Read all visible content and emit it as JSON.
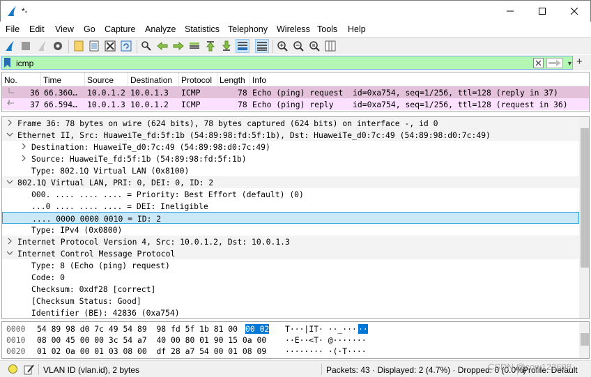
{
  "window": {
    "title": "*-"
  },
  "menu": [
    "File",
    "Edit",
    "View",
    "Go",
    "Capture",
    "Analyze",
    "Statistics",
    "Telephony",
    "Wireless",
    "Tools",
    "Help"
  ],
  "filter": {
    "value": "icmp"
  },
  "packet_list": {
    "columns": [
      "No.",
      "Time",
      "Source",
      "Destination",
      "Protocol",
      "Length",
      "Info"
    ],
    "rows": [
      {
        "no": "36",
        "time": "66.360…",
        "src": "10.0.1.2",
        "dst": "10.0.1.3",
        "proto": "ICMP",
        "len": "78",
        "info": "Echo (ping) request  id=0xa754, seq=1/256, ttl=128 (reply in 37)"
      },
      {
        "no": "37",
        "time": "66.594…",
        "src": "10.0.1.3",
        "dst": "10.0.1.2",
        "proto": "ICMP",
        "len": "78",
        "info": "Echo (ping) reply    id=0xa754, seq=1/256, ttl=128 (request in 36)"
      }
    ]
  },
  "details": [
    {
      "text": "Frame 36: 78 bytes on wire (624 bits), 78 bytes captured (624 bits) on interface -, id 0",
      "arrow": "right"
    },
    {
      "text": "Ethernet II, Src: HuaweiTe_fd:5f:1b (54:89:98:fd:5f:1b), Dst: HuaweiTe_d0:7c:49 (54:89:98:d0:7c:49)",
      "arrow": "down"
    },
    {
      "text": "Destination: HuaweiTe_d0:7c:49 (54:89:98:d0:7c:49)",
      "arrow": "right"
    },
    {
      "text": "Source: HuaweiTe_fd:5f:1b (54:89:98:fd:5f:1b)",
      "arrow": "right"
    },
    {
      "text": "Type: 802.1Q Virtual LAN (0x8100)",
      "arrow": ""
    },
    {
      "text": "802.1Q Virtual LAN, PRI: 0, DEI: 0, ID: 2",
      "arrow": "down"
    },
    {
      "text": "000. .... .... .... = Priority: Best Effort (default) (0)",
      "arrow": ""
    },
    {
      "text": "...0 .... .... .... = DEI: Ineligible",
      "arrow": ""
    },
    {
      "text": ".... 0000 0000 0010 = ID: 2",
      "arrow": ""
    },
    {
      "text": "Type: IPv4 (0x0800)",
      "arrow": ""
    },
    {
      "text": "Internet Protocol Version 4, Src: 10.0.1.2, Dst: 10.0.1.3",
      "arrow": "right"
    },
    {
      "text": "Internet Control Message Protocol",
      "arrow": "down"
    },
    {
      "text": "Type: 8 (Echo (ping) request)",
      "arrow": ""
    },
    {
      "text": "Code: 0",
      "arrow": ""
    },
    {
      "text": "Checksum: 0xdf28 [correct]",
      "arrow": ""
    },
    {
      "text": "[Checksum Status: Good]",
      "arrow": ""
    },
    {
      "text": "Identifier (BE): 42836 (0xa754)",
      "arrow": ""
    }
  ],
  "bytes": [
    {
      "offset": "0000",
      "hex_a": "54 89 98 d0 7c 49 54 89  98 fd 5f 1b 81 00 ",
      "hex_sel": "00 02",
      "ascii_a": "T···|IT· ··_···",
      "ascii_sel": "··"
    },
    {
      "offset": "0010",
      "hex_a": "08 00 45 00 00 3c 54 a7  40 00 80 01 90 15 0a 00",
      "hex_sel": "",
      "ascii_a": "··E··<T· @·······",
      "ascii_sel": ""
    },
    {
      "offset": "0020",
      "hex_a": "01 02 0a 00 01 03 08 00  df 28 a7 54 00 01 08 09",
      "hex_sel": "",
      "ascii_a": "········ ·(·T····",
      "ascii_sel": ""
    }
  ],
  "status": {
    "field": "VLAN ID (vlan.id), 2 bytes",
    "packets": "Packets: 43 · Displayed: 2 (4.7%) · Dropped: 0 (0.0%)",
    "profile": "Profile: Default",
    "watermark": "CSDN @cow123698"
  },
  "colors": {
    "request_row": "#e3c1da",
    "reply_row": "#fce0ff",
    "filter_ok": "#b4f6b4",
    "selection": "#cbe8f6",
    "hex_selected": "#0078d7"
  }
}
